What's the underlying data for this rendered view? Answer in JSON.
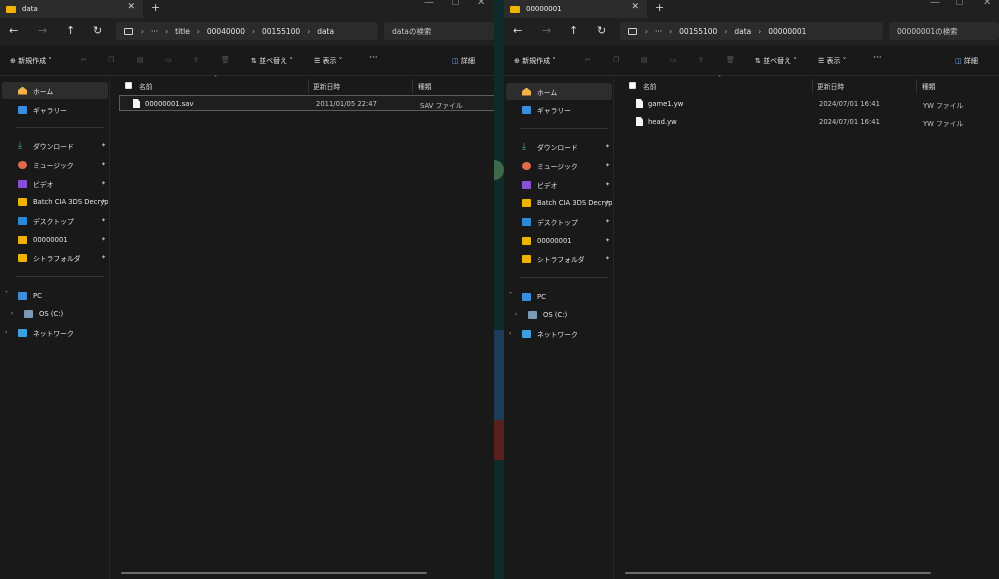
{
  "left": {
    "tab_title": "data",
    "path": [
      "title",
      "00040000",
      "00155100",
      "data"
    ],
    "search_placeholder": "dataの検索",
    "toolbar": {
      "new": "新規作成",
      "sort": "並べ替え",
      "view": "表示",
      "details": "詳細"
    },
    "columns": {
      "name": "名前",
      "date": "更新日時",
      "type": "種類"
    },
    "files": [
      {
        "name": "00000001.sav",
        "date": "2011/01/05 22:47",
        "type": "SAV ファイル"
      }
    ]
  },
  "right": {
    "tab_title": "00000001",
    "path": [
      "00155100",
      "data",
      "00000001"
    ],
    "search_placeholder": "00000001の検索",
    "toolbar": {
      "new": "新規作成",
      "sort": "並べ替え",
      "view": "表示",
      "details": "詳細"
    },
    "columns": {
      "name": "名前",
      "date": "更新日時",
      "type": "種類"
    },
    "files": [
      {
        "name": "game1.yw",
        "date": "2024/07/01 16:41",
        "type": "YW ファイル"
      },
      {
        "name": "head.yw",
        "date": "2024/07/01 16:41",
        "type": "YW ファイル"
      }
    ]
  },
  "sidebar": {
    "home": "ホーム",
    "gallery": "ギャラリー",
    "quick": [
      {
        "label": "ダウンロード",
        "icon": "download-icon",
        "color": "#3fb8a8"
      },
      {
        "label": "ミュージック",
        "icon": "music-icon",
        "color": "#e06a4a"
      },
      {
        "label": "ビデオ",
        "icon": "video-icon",
        "color": "#8a4fd8"
      },
      {
        "label": "Batch CIA 3DS Decrypt",
        "icon": "folder-icon",
        "color": "#f0b400"
      },
      {
        "label": "デスクトップ",
        "icon": "desktop-icon",
        "color": "#2a8ad8"
      },
      {
        "label": "00000001",
        "icon": "folder-icon",
        "color": "#f0b400"
      },
      {
        "label": "シトラフォルダ",
        "icon": "folder-icon",
        "color": "#f0b400"
      }
    ],
    "pc": "PC",
    "os": "OS (C:)",
    "network": "ネットワーク"
  },
  "icons": {
    "more": "···"
  }
}
